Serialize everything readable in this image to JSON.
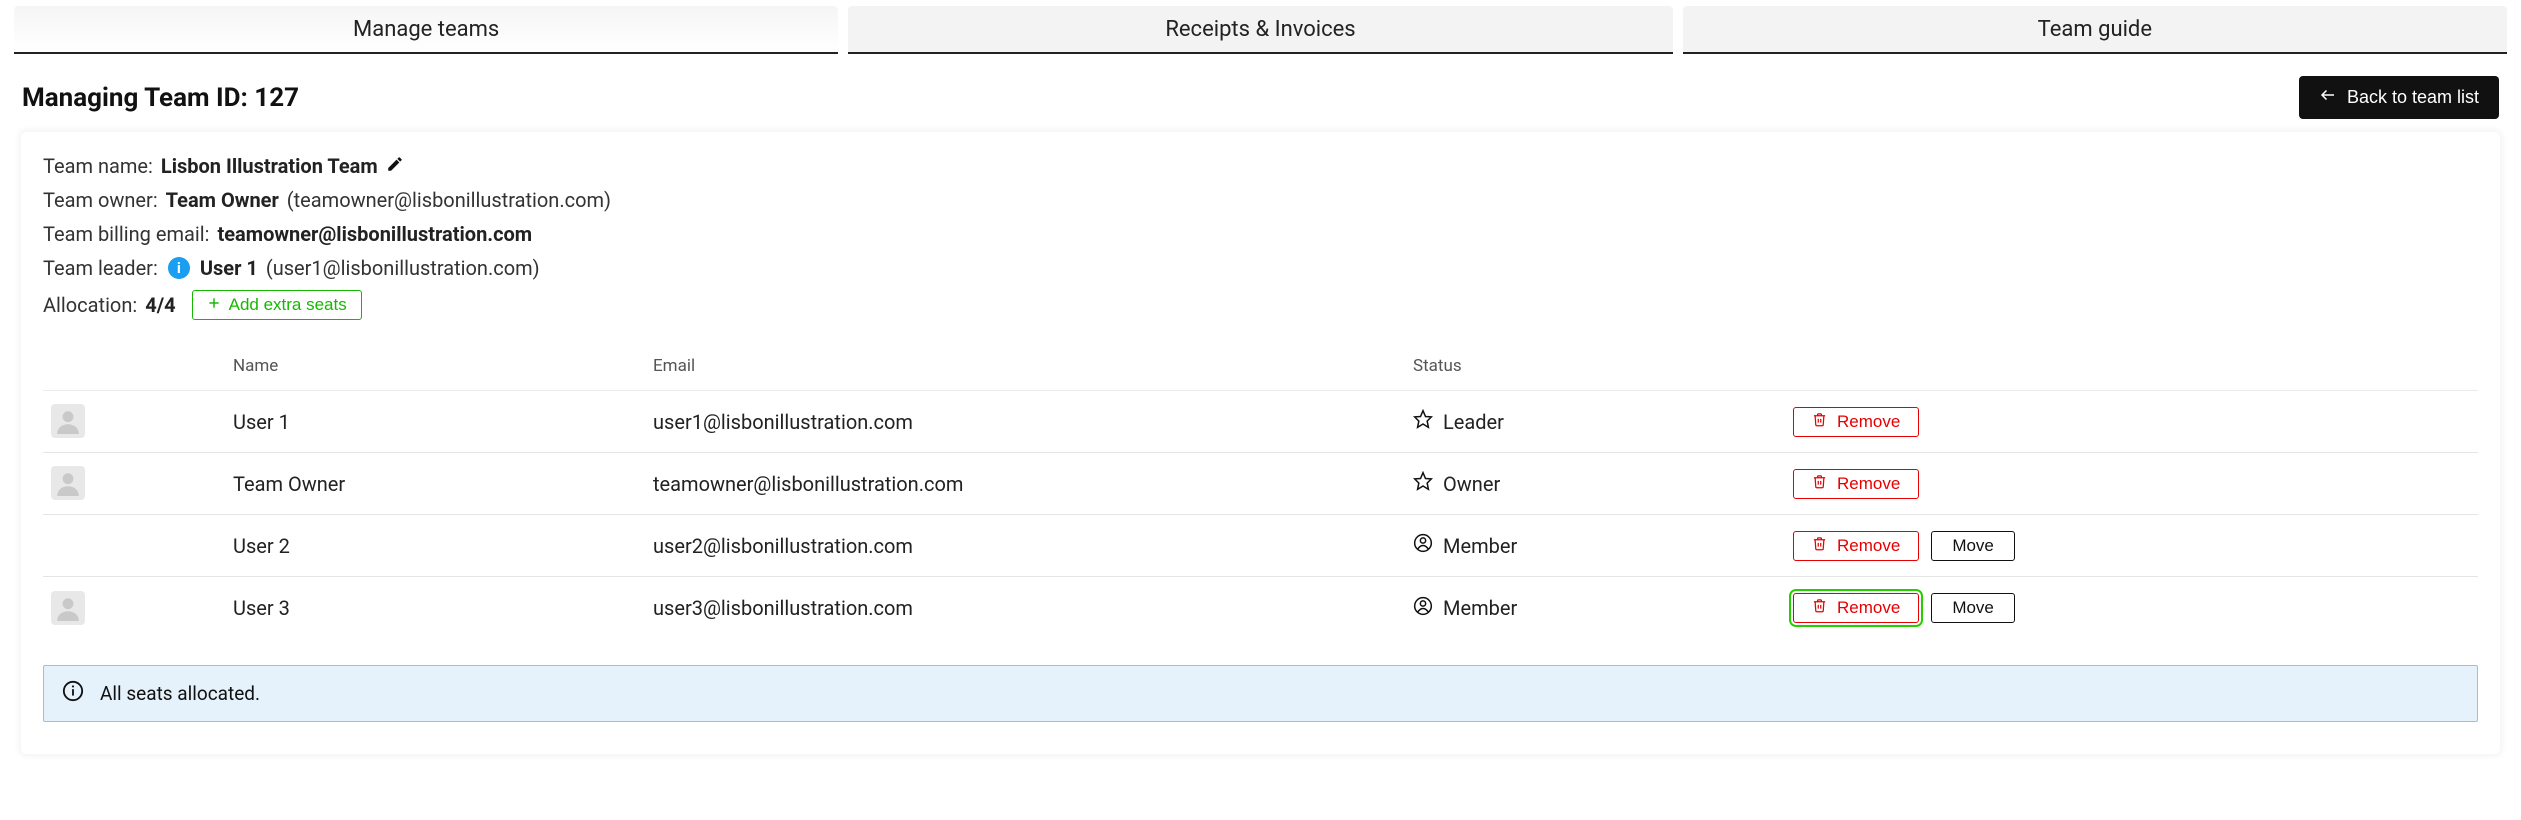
{
  "tabs": {
    "manage": "Manage teams",
    "receipts": "Receipts & Invoices",
    "guide": "Team guide"
  },
  "header": {
    "title": "Managing Team ID: 127",
    "back": "Back to team list"
  },
  "meta": {
    "team_name_label": "Team name:",
    "team_name": "Lisbon Illustration Team",
    "team_owner_label": "Team owner:",
    "team_owner_name": "Team Owner",
    "team_owner_email_paren": "(teamowner@lisbonillustration.com)",
    "billing_label": "Team billing email:",
    "billing_email": "teamowner@lisbonillustration.com",
    "leader_label": "Team leader:",
    "info_letter": "i",
    "leader_name": "User 1",
    "leader_email_paren": "(user1@lisbonillustration.com)",
    "allocation_label": "Allocation:",
    "allocation_value": "4/4",
    "add_seats": "Add extra seats"
  },
  "columns": {
    "avatar": "",
    "name": "Name",
    "email": "Email",
    "status": "Status",
    "actions": ""
  },
  "actions": {
    "remove": "Remove",
    "move": "Move"
  },
  "rows": [
    {
      "avatar": true,
      "name": "User 1",
      "email": "user1@lisbonillustration.com",
      "status": "Leader",
      "status_icon": "star",
      "move": false,
      "highlight": false
    },
    {
      "avatar": true,
      "name": "Team Owner",
      "email": "teamowner@lisbonillustration.com",
      "status": "Owner",
      "status_icon": "star",
      "move": false,
      "highlight": false
    },
    {
      "avatar": false,
      "name": "User 2",
      "email": "user2@lisbonillustration.com",
      "status": "Member",
      "status_icon": "user",
      "move": true,
      "highlight": false
    },
    {
      "avatar": true,
      "name": "User 3",
      "email": "user3@lisbonillustration.com",
      "status": "Member",
      "status_icon": "user",
      "move": true,
      "highlight": true
    }
  ],
  "alert": {
    "text": "All seats allocated."
  }
}
